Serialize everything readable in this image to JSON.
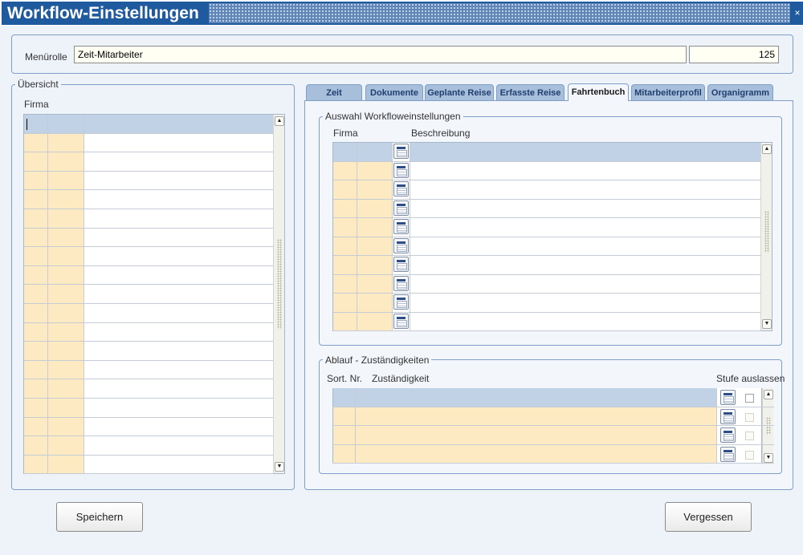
{
  "window": {
    "title": "Workflow-Einstellungen",
    "close_glyph": "×"
  },
  "menurolle": {
    "label": "Menürolle",
    "value": "Zeit-Mitarbeiter",
    "number": "125"
  },
  "overview": {
    "legend": "Übersicht",
    "column_firma": "Firma"
  },
  "tabs": [
    {
      "label": "Zeit",
      "active": false
    },
    {
      "label": "Dokumente",
      "active": false
    },
    {
      "label": "Geplante Reise",
      "active": false
    },
    {
      "label": "Erfasste Reise",
      "active": false
    },
    {
      "label": "Fahrtenbuch",
      "active": true
    },
    {
      "label": "Mitarbeiterprofil",
      "active": false
    },
    {
      "label": "Organigramm",
      "active": false
    }
  ],
  "workflow_selection": {
    "legend": "Auswahl Workfloweinstellungen",
    "col_firma": "Firma",
    "col_beschreibung": "Beschreibung"
  },
  "responsibilities": {
    "legend": "Ablauf - Zuständigkeiten",
    "col_sort": "Sort. Nr.",
    "col_zustaendigkeit": "Zuständigkeit",
    "col_stufe": "Stufe auslassen"
  },
  "buttons": {
    "save": "Speichern",
    "forget": "Vergessen"
  },
  "icons": {
    "calendar": "calendar-icon",
    "scroll_up": "▲",
    "scroll_down": "▼"
  },
  "colors": {
    "title_bg": "#1f5a9e",
    "highlight_cell": "#fde9c2",
    "header_row": "#c2d2e6"
  }
}
